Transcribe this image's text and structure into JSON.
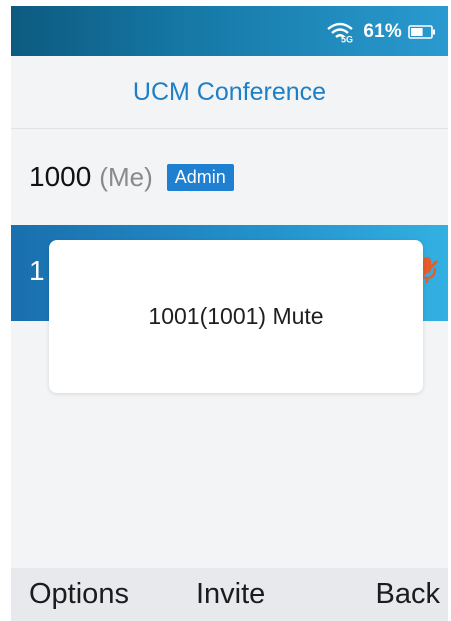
{
  "status_bar": {
    "signal_icon": "wifi-5g-icon",
    "signal_label": "5G",
    "battery_percent": "61%",
    "battery_icon": "battery-icon",
    "battery_level": 0.61
  },
  "header": {
    "title": "UCM Conference"
  },
  "members": [
    {
      "number": "1000",
      "tag": "(Me)",
      "badge": "Admin"
    },
    {
      "number": "1",
      "status_icon": "mic-muted-icon"
    }
  ],
  "toast": {
    "message": "1001(1001) Mute"
  },
  "softkeys": {
    "left": "Options",
    "middle": "Invite",
    "right": "Back"
  },
  "colors": {
    "accent": "#1f7fc6",
    "badge": "#1f7fd0",
    "selected_row": "#2393cc"
  }
}
